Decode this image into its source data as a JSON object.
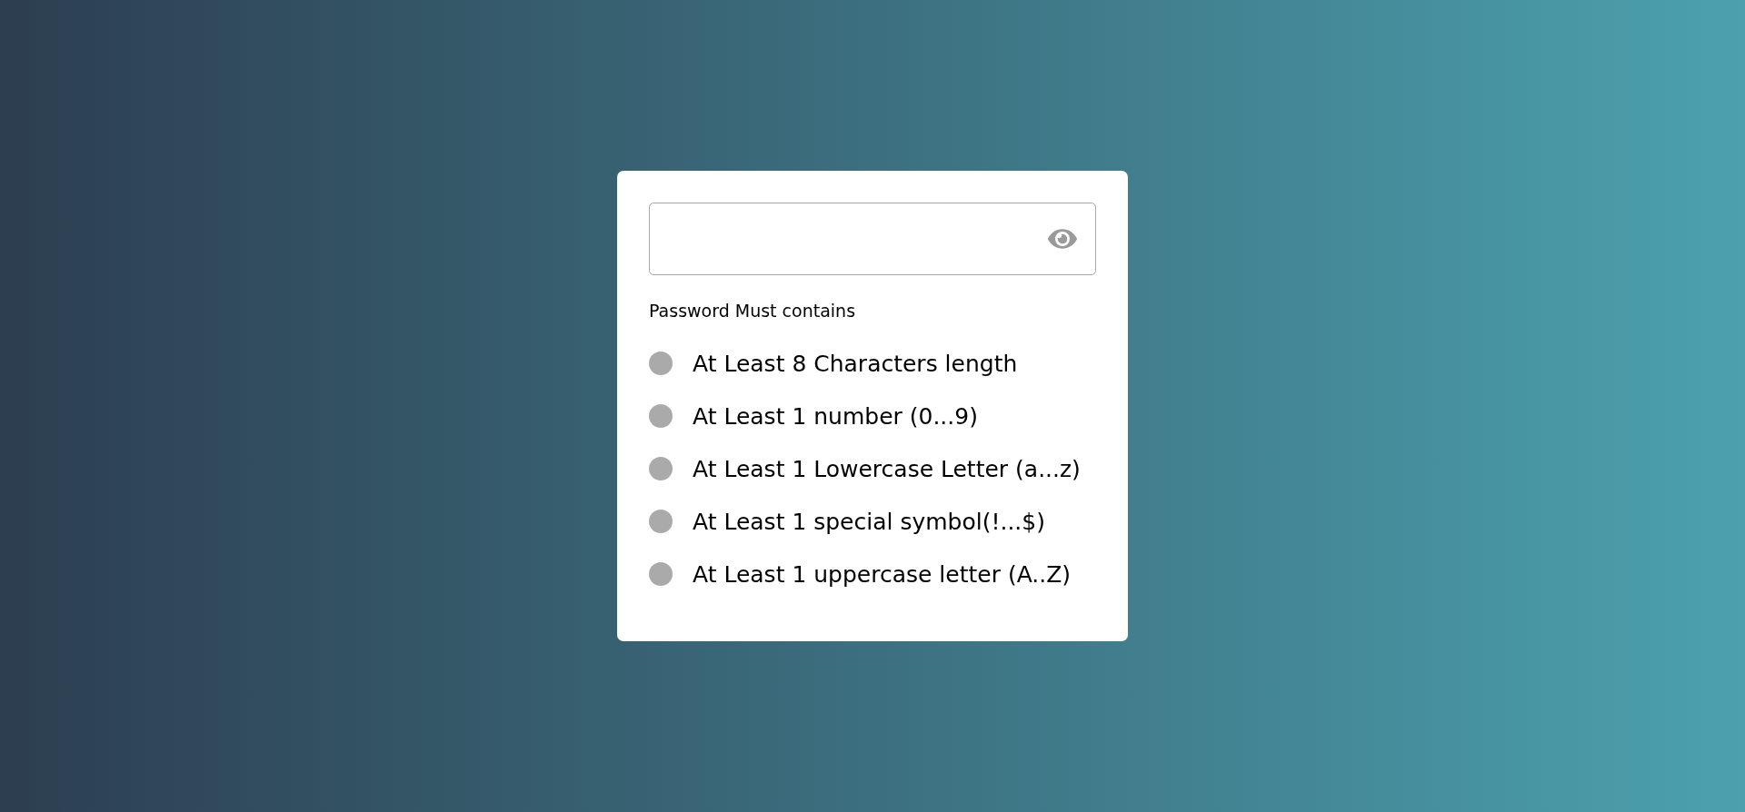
{
  "card": {
    "heading": "Password Must contains",
    "requirements": [
      {
        "label": "At Least 8 Characters length",
        "met": false
      },
      {
        "label": "At Least 1 number (0...9)",
        "met": false
      },
      {
        "label": "At Least 1 Lowercase Letter (a...z)",
        "met": false
      },
      {
        "label": "At Least 1 special symbol(!...$)",
        "met": false
      },
      {
        "label": "At Least 1 uppercase letter (A..Z)",
        "met": false
      }
    ]
  }
}
